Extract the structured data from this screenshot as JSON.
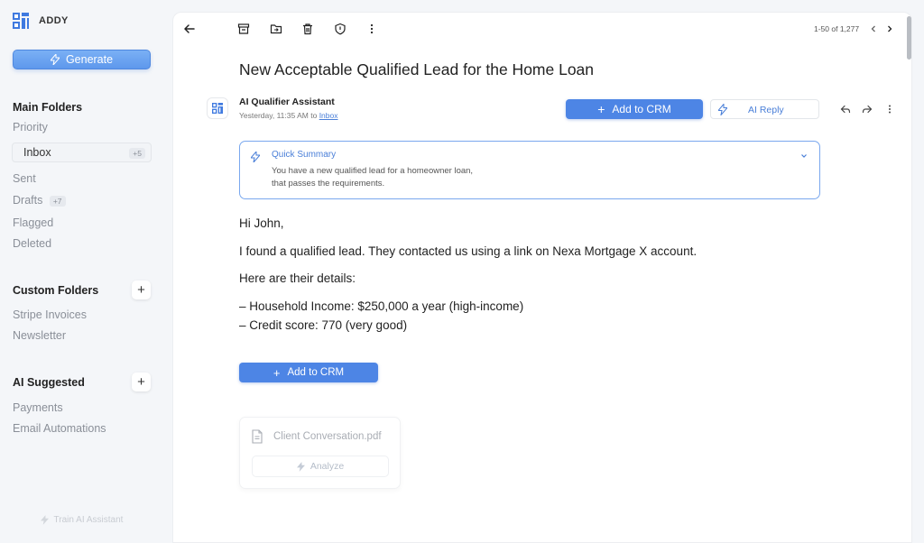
{
  "app": {
    "name": "ADDY"
  },
  "sidebar": {
    "generate_label": "Generate",
    "main_folders": {
      "title": "Main Folders",
      "items": [
        {
          "label": "Priority"
        },
        {
          "label": "Inbox",
          "badge": "+5",
          "active": true
        },
        {
          "label": "Sent"
        },
        {
          "label": "Drafts",
          "badge": "+7"
        },
        {
          "label": "Flagged"
        },
        {
          "label": "Deleted"
        }
      ]
    },
    "custom_folders": {
      "title": "Custom Folders",
      "items": [
        {
          "label": "Stripe Invoices"
        },
        {
          "label": "Newsletter"
        }
      ]
    },
    "ai_suggested": {
      "title": "AI Suggested",
      "items": [
        {
          "label": "Payments"
        },
        {
          "label": "Email Automations"
        }
      ]
    },
    "train_label": "Train AI Assistant"
  },
  "toolbar": {
    "icons": [
      "back-arrow-icon",
      "archive-icon",
      "move-to-folder-icon",
      "trash-icon",
      "shield-icon",
      "more-vertical-icon"
    ],
    "pagination": "1-50 of 1,277"
  },
  "email": {
    "subject": "New Acceptable Qualified Lead for the Home Loan",
    "sender_name": "AI Qualifier Assistant",
    "meta_prefix": "Yesterday, 11:35 AM to ",
    "meta_folder": "Inbox",
    "add_crm_label": "Add to CRM",
    "ai_reply_label": "AI Reply",
    "summary": {
      "title": "Quick Summary",
      "line1": "You have a new qualified lead for a homeowner loan,",
      "line2": "that passes the requirements."
    },
    "body": {
      "greeting": "Hi John,",
      "p1": "I found a qualified lead. They contacted us using a link on Nexa Mortgage X account.",
      "p2": "Here are their details:",
      "d1": "– Household Income: $250,000 a year (high-income)",
      "d2": "– Credit score: 770 (very good)"
    },
    "attachment": {
      "filename": "Client Conversation.pdf",
      "analyze_label": "Analyze"
    }
  },
  "colors": {
    "accent": "#4d85e5",
    "accent_text": "#4a7fd8",
    "background": "#f4f6f9"
  }
}
